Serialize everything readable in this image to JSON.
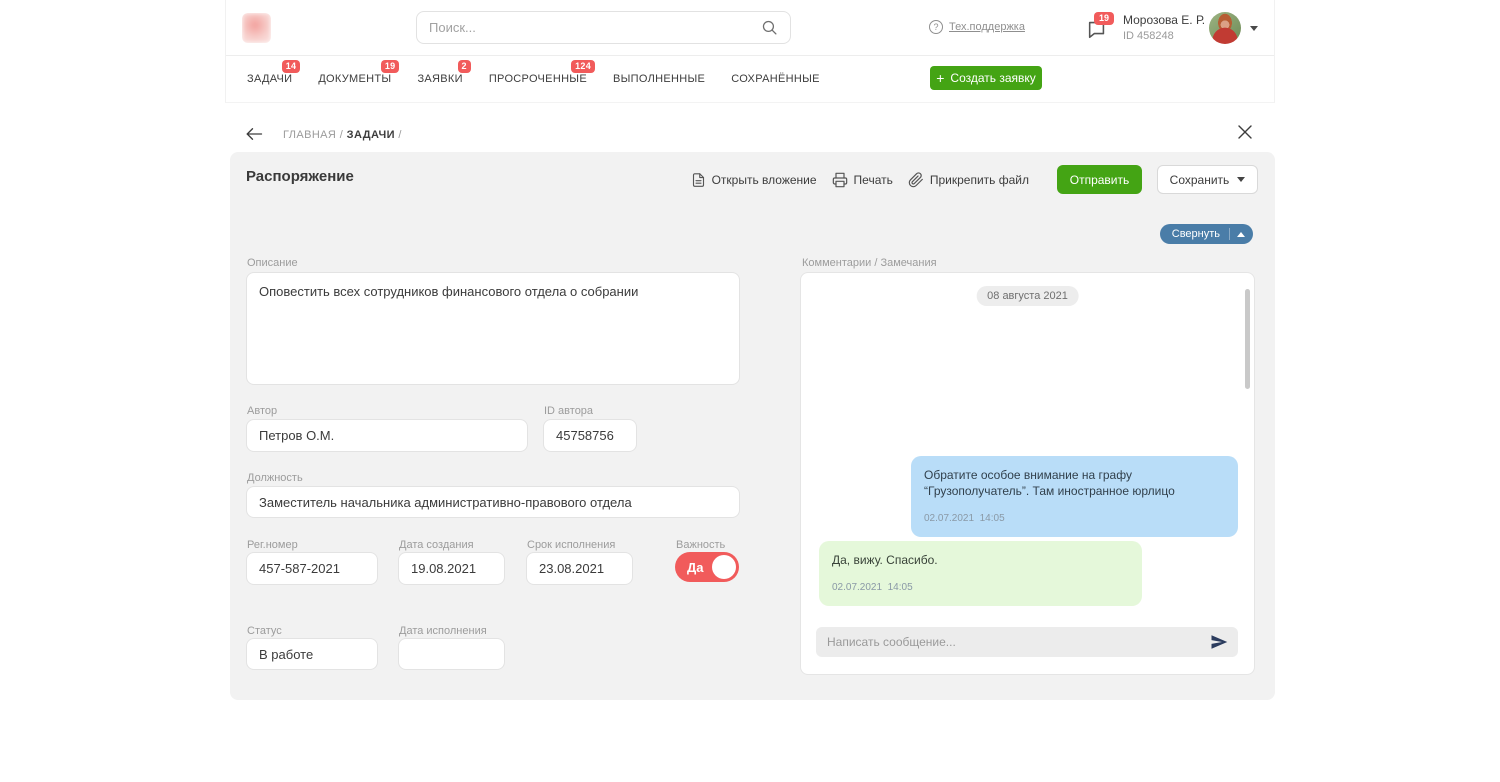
{
  "header": {
    "search": {
      "placeholder": "Поиск..."
    },
    "support": {
      "label": "Тех.поддержка",
      "icon_text": "?"
    },
    "notifications": {
      "count": "19"
    },
    "user": {
      "name": "Морозова Е. Р.",
      "id": "ID 458248"
    }
  },
  "nav": {
    "tabs": [
      {
        "label": "ЗАДАЧИ",
        "badge": "14"
      },
      {
        "label": "ДОКУМЕНТЫ",
        "badge": "19"
      },
      {
        "label": "ЗАЯВКИ",
        "badge": "2"
      },
      {
        "label": "ПРОСРОЧЕННЫЕ",
        "badge": "124"
      },
      {
        "label": "ВЫПОЛНЕННЫЕ",
        "badge": ""
      },
      {
        "label": "СОХРАНЁННЫЕ",
        "badge": ""
      }
    ],
    "create_plus": "+",
    "create_button": "Создать заявку"
  },
  "breadcrumb": {
    "root": "ГЛАВНАЯ",
    "separator": "/",
    "current": "ЗАДАЧИ",
    "trailing": "/"
  },
  "document": {
    "title": "Распоряжение",
    "actions": {
      "open_attachment": "Открыть вложение",
      "print": "Печать",
      "attach_file": "Прикрепить файл",
      "send": "Отправить",
      "save": "Сохранить"
    },
    "collapse": "Свернуть",
    "form": {
      "description": {
        "label": "Описание",
        "value": "Оповестить всех сотрудников финансового отдела о собрании"
      },
      "author": {
        "label": "Автор",
        "value": "Петров О.М."
      },
      "author_id": {
        "label": "ID автора",
        "value": "45758756"
      },
      "position": {
        "label": "Должность",
        "value": "Заместитель начальника административно-правового отдела"
      },
      "reg_number": {
        "label": "Рег.номер",
        "value": "457-587-2021"
      },
      "created": {
        "label": "Дата создания",
        "value": "19.08.2021"
      },
      "due": {
        "label": "Срок исполнения",
        "value": "23.08.2021"
      },
      "importance": {
        "label": "Важность",
        "value": "Да",
        "state": "on"
      },
      "status": {
        "label": "Статус",
        "value": "В работе"
      },
      "completed": {
        "label": "Дата исполнения",
        "value": ""
      }
    }
  },
  "comments": {
    "label": "Комментарии / Замечания",
    "date_divider": "08 августа 2021",
    "messages": [
      {
        "type": "incoming",
        "text": "Обратите особое внимание на графу “Грузополучатель”. Там иностранное юрлицо",
        "time": "02.07.2021  14:05"
      },
      {
        "type": "outgoing",
        "text": "Да, вижу. Спасибо.",
        "time": "02.07.2021  14:05"
      }
    ],
    "input_placeholder": "Написать сообщение..."
  },
  "colors": {
    "accent_green": "#44a414",
    "badge_red": "#f15b5b",
    "collapse_blue": "#4a7da8",
    "incoming_bubble": "#b9ddf8",
    "outgoing_bubble": "#e5f8da",
    "card_background": "#f2f2f2"
  }
}
